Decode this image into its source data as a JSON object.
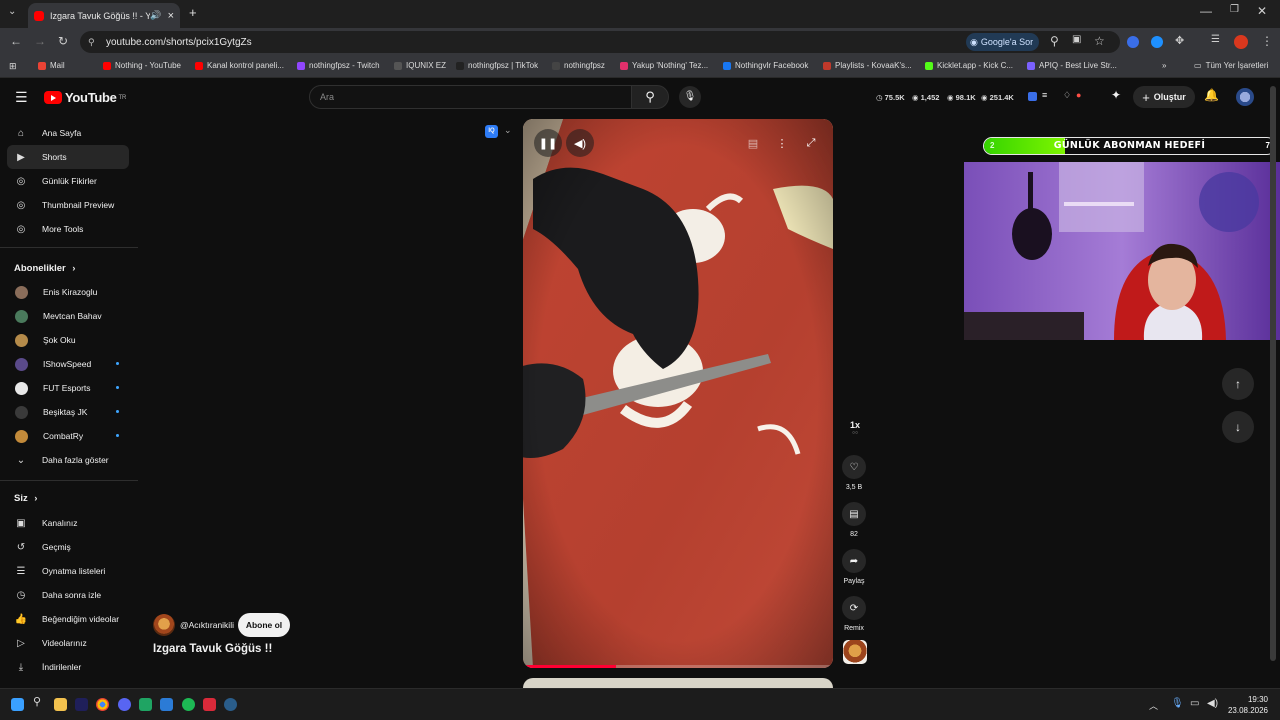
{
  "browser": {
    "tab_title": "Izgara Tavuk Göğüs !! - You",
    "url": "youtube.com/shorts/pcix1GytgZs",
    "google_lens": "Google'a Sor",
    "bookmarks": [
      {
        "label": "Mail",
        "color": "#ea4335"
      },
      {
        "label": "Nothing - YouTube",
        "color": "#ff0000"
      },
      {
        "label": "Kanal kontrol paneli...",
        "color": "#ff0000"
      },
      {
        "label": "nothingfpsz - Twitch",
        "color": "#9146ff"
      },
      {
        "label": "IQUNIX EZ",
        "color": "#555555"
      },
      {
        "label": "nothingfpsz | TikTok",
        "color": "#222222"
      },
      {
        "label": "nothingfpsz",
        "color": "#444444"
      },
      {
        "label": "Yakup 'Nothing' Tez...",
        "color": "#e1306c"
      },
      {
        "label": "Nothingvlr Facebook",
        "color": "#1877f2"
      },
      {
        "label": "Playlists - KovaaK's...",
        "color": "#c0392b"
      },
      {
        "label": "Kicklet.app - Kick C...",
        "color": "#53fc18"
      },
      {
        "label": "APIQ - Best Live Str...",
        "color": "#7b61ff"
      }
    ],
    "all_bookmarks": "Tüm Yer İşaretleri"
  },
  "youtube": {
    "logo": "YouTube",
    "region": "TR",
    "search_placeholder": "Ara",
    "stats": [
      "75.5K",
      "1,452",
      "98.1K",
      "251.4K"
    ],
    "create": "Oluştur"
  },
  "sidebar": {
    "main": [
      {
        "label": "Ana Sayfa",
        "icon": "home-icon"
      },
      {
        "label": "Shorts",
        "icon": "shorts-icon",
        "active": true
      },
      {
        "label": "Günlük Fikirler",
        "icon": "extension-icon"
      },
      {
        "label": "Thumbnail Preview",
        "icon": "extension-icon"
      },
      {
        "label": "More Tools",
        "icon": "extension-icon"
      }
    ],
    "subs_header": "Abonelikler",
    "subs": [
      {
        "label": "Enis Kirazoglu",
        "color": "#8a6d5a",
        "dot": false
      },
      {
        "label": "Mevtcan Bahav",
        "color": "#4a7a5c",
        "dot": false
      },
      {
        "label": "Şok Oku",
        "color": "#b58b4a",
        "dot": false
      },
      {
        "label": "IShowSpeed",
        "color": "#5a4a8a",
        "dot": true
      },
      {
        "label": "FUT Esports",
        "color": "#e8e8e8",
        "dot": true
      },
      {
        "label": "Beşiktaş JK",
        "color": "#3a3a3a",
        "dot": true
      },
      {
        "label": "CombatRy",
        "color": "#c28a3a",
        "dot": true
      }
    ],
    "show_more": "Daha fazla göster",
    "you_header": "Siz",
    "you": [
      {
        "label": "Kanalınız",
        "icon": "channel-icon"
      },
      {
        "label": "Geçmiş",
        "icon": "history-icon"
      },
      {
        "label": "Oynatma listeleri",
        "icon": "playlist-icon"
      },
      {
        "label": "Daha sonra izle",
        "icon": "clock-icon"
      },
      {
        "label": "Beğendiğim videolar",
        "icon": "like-icon"
      },
      {
        "label": "Videolarınız",
        "icon": "video-icon"
      },
      {
        "label": "İndirilenler",
        "icon": "download-icon"
      }
    ]
  },
  "short": {
    "channel": "@Acıktıranikili",
    "subscribe": "Abone ol",
    "title": "Izgara Tavuk Göğüs !!",
    "speed": "1x",
    "likes": "3,5 B",
    "comments": "82",
    "share": "Paylaş",
    "remix": "Remix",
    "progress": 0.3
  },
  "overlay": {
    "goal_label": "GÜNLÜK ABONMAN HEDEFİ",
    "goal_current": "2",
    "goal_target": "7",
    "goal_fraction": 0.28
  },
  "taskbar": {
    "time": "19:30",
    "date": "23.08.2026"
  }
}
